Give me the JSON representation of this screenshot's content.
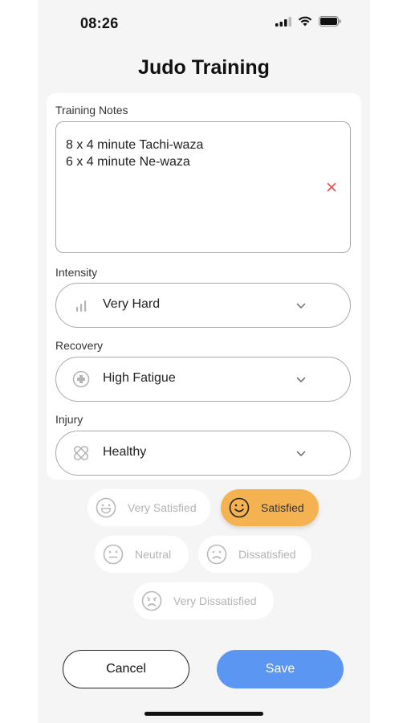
{
  "status_bar": {
    "time": "08:26"
  },
  "header": {
    "title": "Judo Training"
  },
  "notes": {
    "label": "Training Notes",
    "value": "8 x 4 minute Tachi-waza\n6 x 4 minute Ne-waza"
  },
  "intensity": {
    "label": "Intensity",
    "value": "Very Hard",
    "icon": "signal-bars-icon"
  },
  "recovery": {
    "label": "Recovery",
    "value": "High Fatigue",
    "icon": "medical-cross-icon"
  },
  "injury": {
    "label": "Injury",
    "value": "Healthy",
    "icon": "bandage-icon"
  },
  "satisfaction": {
    "options": [
      {
        "label": "Very Satisfied",
        "icon": "grin-face-icon",
        "selected": false
      },
      {
        "label": "Satisfied",
        "icon": "smile-face-icon",
        "selected": true
      },
      {
        "label": "Neutral",
        "icon": "neutral-face-icon",
        "selected": false
      },
      {
        "label": "Dissatisfied",
        "icon": "frown-face-icon",
        "selected": false
      },
      {
        "label": "Very Dissatisfied",
        "icon": "sad-face-icon",
        "selected": false
      }
    ]
  },
  "actions": {
    "cancel_label": "Cancel",
    "save_label": "Save"
  },
  "colors": {
    "accent_blue": "#5b96f2",
    "selected_orange": "#f4b350",
    "clear_red": "#e05050"
  }
}
